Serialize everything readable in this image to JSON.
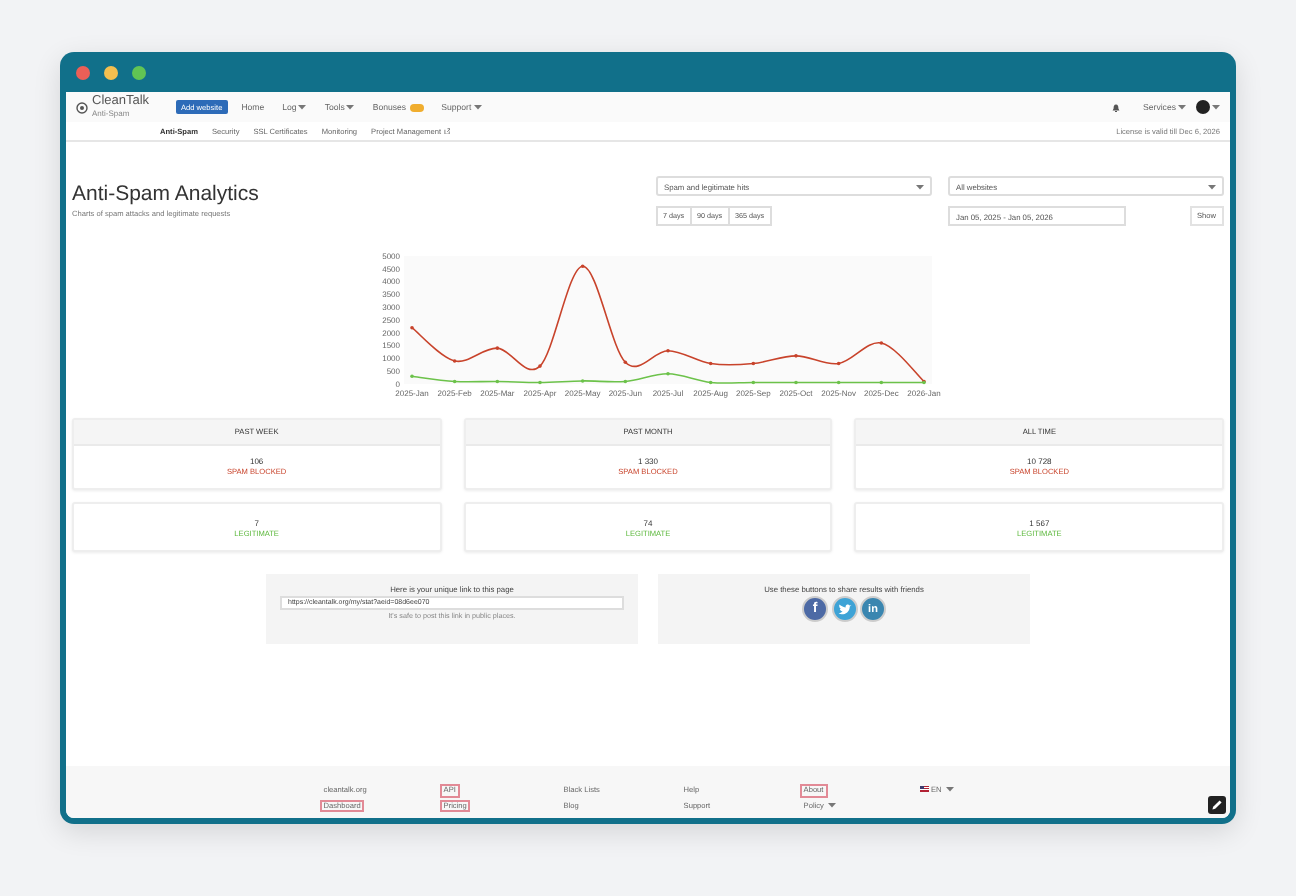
{
  "window": {
    "traffic_lights": [
      {
        "color": "#ec5f57"
      },
      {
        "color": "#f4bf4f"
      },
      {
        "color": "#61c454"
      }
    ]
  },
  "nav": {
    "logo": {
      "name": "CleanTalk",
      "tagline": "Anti-Spam"
    },
    "add_button": "Add website",
    "menu": [
      {
        "label": "Home",
        "dropdown": false
      },
      {
        "label": "Log",
        "dropdown": true
      },
      {
        "label": "Tools",
        "dropdown": true
      },
      {
        "label": "Bonuses",
        "dropdown": false,
        "has_badge": true
      },
      {
        "label": "Support",
        "dropdown": true
      }
    ],
    "services": {
      "label": "Services",
      "dropdown": true
    },
    "subnav": [
      {
        "label": "Anti-Spam",
        "selected": true
      },
      {
        "label": "Security",
        "selected": false
      },
      {
        "label": "SSL Certificates",
        "selected": false
      },
      {
        "label": "Monitoring",
        "selected": false
      },
      {
        "label": "Project Management",
        "selected": false,
        "external": true
      }
    ],
    "license": "License is valid till Dec 6, 2026"
  },
  "page": {
    "title": "Anti-Spam Analytics",
    "subtitle": "Charts of spam attacks and legitimate requests"
  },
  "filters": {
    "hit_type": "Spam and legitimate hits",
    "website": "All websites",
    "ranges": [
      {
        "label": "7 days",
        "selected": false
      },
      {
        "label": "90 days",
        "selected": false
      },
      {
        "label": "365 days",
        "selected": false
      }
    ],
    "date_range": "Jan 05, 2025 - Jan 05, 2026",
    "show_button": "Show"
  },
  "chart": {
    "chart_data": {
      "type": "line",
      "categories": [
        "2025-Jan",
        "2025-Feb",
        "2025-Mar",
        "2025-Apr",
        "2025-May",
        "2025-Jun",
        "2025-Jul",
        "2025-Aug",
        "2025-Sep",
        "2025-Oct",
        "2025-Nov",
        "2025-Dec",
        "2026-Jan"
      ],
      "series": [
        {
          "color": "#c8432b",
          "values": [
            2200,
            900,
            1400,
            700,
            4600,
            850,
            1300,
            800,
            800,
            1100,
            800,
            1600,
            100
          ]
        },
        {
          "color": "#6cc24a",
          "values": [
            300,
            100,
            100,
            60,
            120,
            100,
            400,
            60,
            60,
            60,
            60,
            60,
            60
          ]
        }
      ],
      "ylim": [
        0,
        5000
      ],
      "yticks": [
        0,
        500,
        1000,
        1500,
        2000,
        2500,
        3000,
        3500,
        4000,
        4500,
        5000
      ]
    }
  },
  "stats": [
    {
      "period": "PAST WEEK",
      "spam": "106",
      "spam_label": "SPAM BLOCKED",
      "legit": "7",
      "legit_label": "LEGITIMATE"
    },
    {
      "period": "PAST MONTH",
      "spam": "1 330",
      "spam_label": "SPAM BLOCKED",
      "legit": "74",
      "legit_label": "LEGITIMATE"
    },
    {
      "period": "ALL TIME",
      "spam": "10 728",
      "spam_label": "SPAM BLOCKED",
      "legit": "1 567",
      "legit_label": "LEGITIMATE"
    }
  ],
  "link_panel": {
    "heading": "Here is your unique link to this page",
    "url": "https://cleantalk.org/my/stat?aeid=08d6ee070",
    "note": "It's safe to post this link in public places."
  },
  "share_panel": {
    "heading": "Use these buttons to share results with friends",
    "buttons": [
      {
        "kind": "facebook",
        "glyph": "f"
      },
      {
        "kind": "twitter"
      },
      {
        "kind": "linkedin",
        "glyph": "in"
      }
    ]
  },
  "footer": {
    "columns": [
      [
        {
          "label": "cleantalk.org",
          "outlined": false
        },
        {
          "label": "Dashboard",
          "outlined": true
        }
      ],
      [
        {
          "label": "API",
          "outlined": true
        },
        {
          "label": "Pricing",
          "outlined": true
        }
      ],
      [
        {
          "label": "Black Lists",
          "outlined": false
        },
        {
          "label": "Blog",
          "outlined": false
        }
      ],
      [
        {
          "label": "Help",
          "outlined": false
        },
        {
          "label": "Support",
          "outlined": false
        }
      ],
      [
        {
          "label": "About",
          "outlined": true
        },
        {
          "label": "Policy",
          "outlined": false,
          "dropdown": true
        }
      ]
    ],
    "language": "EN"
  }
}
